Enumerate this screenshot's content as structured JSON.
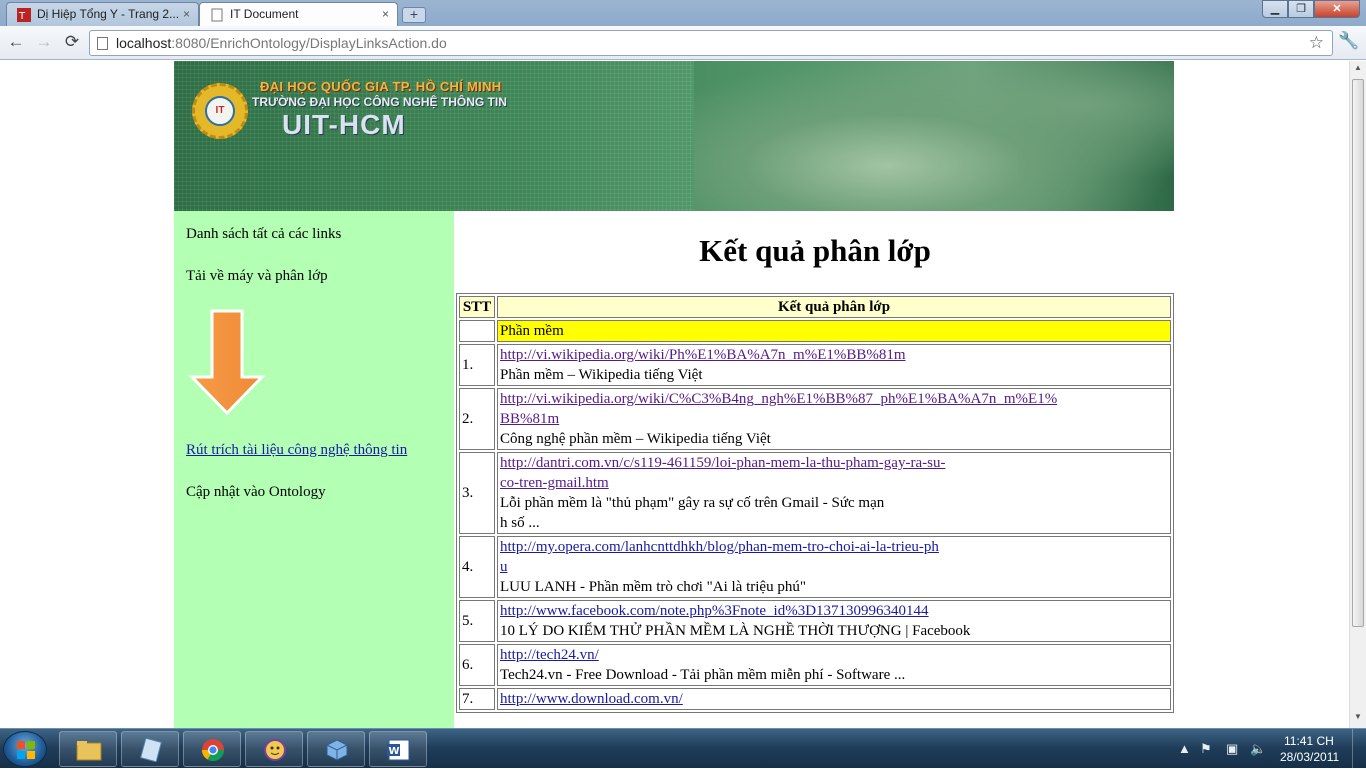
{
  "browser": {
    "tabs": [
      {
        "title": "Dị Hiệp Tổng Y - Trang 2..."
      },
      {
        "title": "IT Document"
      }
    ],
    "new_tab": "+",
    "url_host": "localhost",
    "url_rest": ":8080/EnrichOntology/DisplayLinksAction.do",
    "controls": {
      "back": "←",
      "forward": "→",
      "reload": "⟳",
      "star": "☆",
      "wrench": "🔧",
      "minimize": "▁",
      "maximize": "❐",
      "close": "✕",
      "tab_close": "×"
    }
  },
  "banner": {
    "line1": "ĐẠI HỌC QUỐC GIA TP. HỒ CHÍ MINH",
    "line2": "TRƯỜNG ĐẠI HỌC CÔNG NGHỆ THÔNG TIN",
    "line3": "UIT-HCM",
    "logo_text": "IT"
  },
  "sidebar": {
    "item1": "Danh sách tất cả các links",
    "item2": "Tải về máy và phân lớp",
    "link": "Rút trích tài liệu công nghệ thông tin",
    "item4": "Cập nhật vào Ontology",
    "arrow_icon": "orange-down-arrow"
  },
  "main": {
    "title": "Kết quả phân lớp",
    "table": {
      "headers": {
        "stt": "STT",
        "result": "Kết quả phân lớp"
      },
      "category": "Phần mềm",
      "rows": [
        {
          "num": "1.",
          "url_lines": [
            "http://vi.wikipedia.org/wiki/Ph%E1%BA%A7n_m%E1%BB%81m "
          ],
          "visited": true,
          "desc_lines": [
            "Phần mềm – Wikipedia tiếng Việt"
          ]
        },
        {
          "num": "2.",
          "url_lines": [
            "http://vi.wikipedia.org/wiki/C%C3%B4ng_ngh%E1%BB%87_ph%E1%BA%A7n_m%E1%",
            "BB%81m "
          ],
          "visited": true,
          "desc_lines": [
            "Công nghệ phần mềm – Wikipedia tiếng Việt"
          ]
        },
        {
          "num": "3.",
          "url_lines": [
            "http://dantri.com.vn/c/s119-461159/loi-phan-mem-la-thu-pham-gay-ra-su-",
            "co-tren-gmail.htm "
          ],
          "visited": true,
          "desc_lines": [
            "Lỗi phần mềm là \"thủ phạm\" gây ra sự cố trên Gmail - Sức mạn",
            "h số ..."
          ]
        },
        {
          "num": "4.",
          "url_lines": [
            "http://my.opera.com/lanhcnttdhkh/blog/phan-mem-tro-choi-ai-la-trieu-ph",
            "u "
          ],
          "visited": false,
          "desc_lines": [
            "LUU LANH - Phần mềm trò chơi \"Ai là triệu phú\""
          ]
        },
        {
          "num": "5.",
          "url_lines": [
            "http://www.facebook.com/note.php%3Fnote_id%3D137130996340144 "
          ],
          "visited": false,
          "desc_lines": [
            "10 LÝ DO KIỂM THỬ PHẦN MỀM LÀ NGHỀ THỜI THƯỢNG | Facebook"
          ]
        },
        {
          "num": "6.",
          "url_lines": [
            "http://tech24.vn/ "
          ],
          "visited": false,
          "desc_lines": [
            "Tech24.vn - Free Download - Tải phần mềm miễn phí - Software ..."
          ]
        },
        {
          "num": "7.",
          "url_lines": [
            "http://www.download.com.vn/ "
          ],
          "visited": false,
          "desc_lines": [
            ""
          ]
        }
      ]
    }
  },
  "taskbar": {
    "apps": [
      "windows-explorer-icon",
      "notepad-icon",
      "chrome-icon",
      "yahoo-messenger-icon",
      "virtualbox-icon",
      "word-icon"
    ],
    "time": "11:41 CH",
    "date": "28/03/2011",
    "tray_icons": [
      "show-hidden-icon",
      "flag-icon",
      "network-icon",
      "volume-icon"
    ]
  }
}
